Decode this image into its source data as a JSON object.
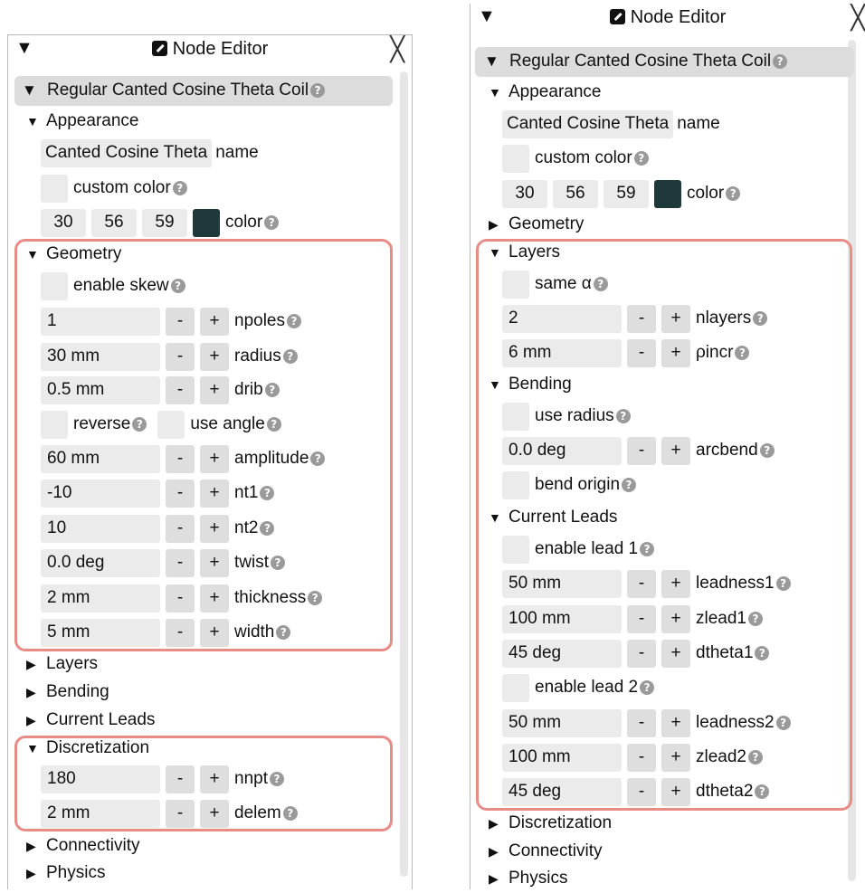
{
  "left_panel": {
    "title": "Node Editor",
    "node_name": "Regular Canted Cosine Theta Coil",
    "appearance": {
      "heading": "Appearance",
      "name_value": "Canted Cosine Theta",
      "name_label": "name",
      "custom_color_label": "custom color",
      "color_r": "30",
      "color_g": "56",
      "color_b": "59",
      "color_label": "color",
      "swatch_hex": "#1e383b"
    },
    "geometry": {
      "heading": "Geometry",
      "enable_skew_label": "enable skew",
      "npoles": "1",
      "npoles_label": "npoles",
      "radius": "30 mm",
      "radius_label": "radius",
      "drib": "0.5 mm",
      "drib_label": "drib",
      "reverse_label": "reverse",
      "use_angle_label": "use angle",
      "amplitude": "60 mm",
      "amplitude_label": "amplitude",
      "nt1": "-10",
      "nt1_label": "nt1",
      "nt2": "10",
      "nt2_label": "nt2",
      "twist": "0.0 deg",
      "twist_label": "twist",
      "thickness": "2 mm",
      "thickness_label": "thickness",
      "width": "5 mm",
      "width_label": "width"
    },
    "layers_heading": "Layers",
    "bending_heading": "Bending",
    "current_leads_heading": "Current Leads",
    "discretization": {
      "heading": "Discretization",
      "nnpt": "180",
      "nnpt_label": "nnpt",
      "delem": "2 mm",
      "delem_label": "delem"
    },
    "connectivity_heading": "Connectivity",
    "physics_heading": "Physics"
  },
  "right_panel": {
    "title": "Node Editor",
    "node_name": "Regular Canted Cosine Theta Coil",
    "appearance": {
      "heading": "Appearance",
      "name_value": "Canted Cosine Theta",
      "name_label": "name",
      "custom_color_label": "custom color",
      "color_r": "30",
      "color_g": "56",
      "color_b": "59",
      "color_label": "color",
      "swatch_hex": "#1e383b"
    },
    "geometry_heading": "Geometry",
    "layers": {
      "heading": "Layers",
      "same_alpha_label": "same α",
      "nlayers": "2",
      "nlayers_label": "nlayers",
      "rhoincr": "6 mm",
      "rhoincr_label": "ρincr"
    },
    "bending": {
      "heading": "Bending",
      "use_radius_label": "use radius",
      "arcbend": "0.0 deg",
      "arcbend_label": "arcbend",
      "bend_origin_label": "bend origin"
    },
    "current_leads": {
      "heading": "Current Leads",
      "enable_lead1_label": "enable lead 1",
      "leadness1": "50 mm",
      "leadness1_label": "leadness1",
      "zlead1": "100 mm",
      "zlead1_label": "zlead1",
      "dtheta1": "45 deg",
      "dtheta1_label": "dtheta1",
      "enable_lead2_label": "enable lead 2",
      "leadness2": "50 mm",
      "leadness2_label": "leadness2",
      "zlead2": "100 mm",
      "zlead2_label": "zlead2",
      "dtheta2": "45 deg",
      "dtheta2_label": "dtheta2"
    },
    "discretization_heading": "Discretization",
    "connectivity_heading": "Connectivity",
    "physics_heading": "Physics"
  },
  "common": {
    "collapse_glyph": "▼",
    "expanded_glyph": "▼",
    "collapsed_glyph": "▶",
    "close_glyph": "╳",
    "help_glyph": "?",
    "minus": "-",
    "plus": "+"
  },
  "icons": {
    "edit": "edit-icon",
    "help": "help-icon",
    "close": "close-icon"
  },
  "colors": {
    "highlight": "#e88c86",
    "header_bg": "#dcdcdc",
    "field_bg": "#ebebeb"
  }
}
